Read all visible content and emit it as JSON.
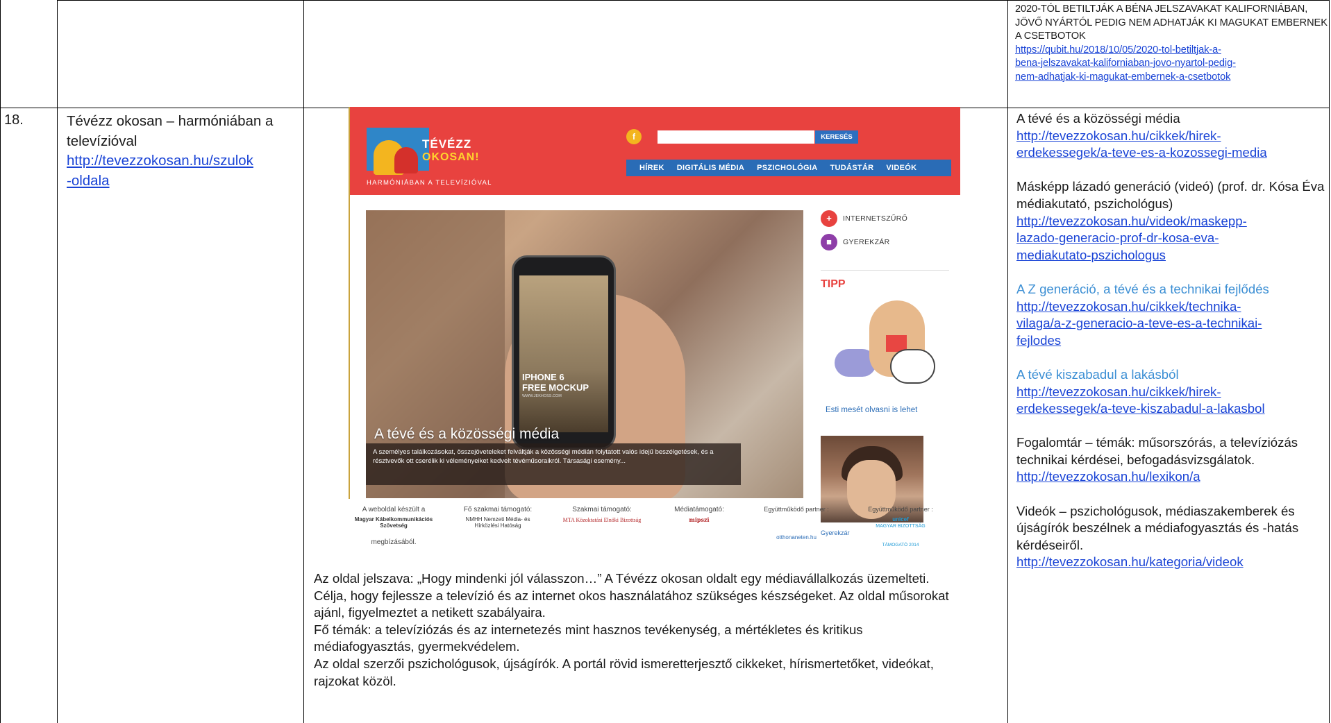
{
  "row17": {
    "headline": "2020-TÓL BETILTJÁK A BÉNA JELSZAVAKAT KALIFORNIÁBAN, JÖVŐ NYÁRTÓL PEDIG NEM ADHATJÁK KI MAGUKAT EMBERNEK A CSETBOTOK",
    "url_lines": [
      "https://qubit.hu/2018/10/05/2020-tol-betiltjak-a-",
      "bena-jelszavakat-kaliforniaban-jovo-nyartol-pedig-",
      "nem-adhatjak-ki-magukat-embernek-a-csetbotok"
    ]
  },
  "row18": {
    "number": "18.",
    "title": "Tévézz okosan – harmóniában a televízióval",
    "url_lines": [
      "http://tevezzokosan.hu/szulok",
      "-oldala"
    ],
    "description": [
      "Az oldal jelszava: „Hogy mindenki jól válasszon…” A Tévézz okosan oldalt egy médiavállalkozás üzemelteti.",
      "Célja, hogy fejlessze a televízió és az internet okos használatához szükséges készségeket. Az oldal műsorokat ajánl, figyelmeztet a netikett szabályaira.",
      "Fő témák: a televíziózás és az internetezés mint hasznos tevékenység, a mértékletes és kritikus médiafogyasztás, gyermekvédelem.",
      "Az oldal szerzői pszichológusok, újságírók. A portál rövid ismeretterjesztő cikkeket, hírismertetőket, videókat, rajzokat közöl."
    ],
    "refs": [
      {
        "title": "A tévé és a közösségi média",
        "url_lines": [
          "http://tevezzokosan.hu/cikkek/hirek-",
          "erdekessegek/a-teve-es-a-kozossegi-media"
        ],
        "accent": false
      },
      {
        "title": "Másképp lázadó generáció (videó) (prof. dr. Kósa Éva médiakutató, pszichológus)",
        "url_lines": [
          "http://tevezzokosan.hu/videok/maskepp-",
          "lazado-generacio-prof-dr-kosa-eva-",
          "mediakutato-pszichologus"
        ],
        "accent": false
      },
      {
        "title": "A Z generáció, a tévé és a technikai fejlődés",
        "url_lines": [
          "http://tevezzokosan.hu/cikkek/technika-",
          "vilaga/a-z-generacio-a-teve-es-a-technikai-",
          "fejlodes"
        ],
        "accent": true
      },
      {
        "title": "A tévé kiszabadul a lakásból",
        "url_lines": [
          "http://tevezzokosan.hu/cikkek/hirek-",
          "erdekessegek/a-teve-kiszabadul-a-lakasbol"
        ],
        "accent": true
      },
      {
        "title": "Fogalomtár – témák: műsorszórás, a televíziózás technikai kérdései, befogadásvizsgálatok.",
        "url_lines": [
          "http://tevezzokosan.hu/lexikon/a"
        ],
        "accent": false
      },
      {
        "title": "Videók – pszichológusok, médiaszakemberek és újságírók beszélnek a médiafogyasztás és -hatás kérdéseiről.",
        "url_lines": [
          "http://tevezzokosan.hu/kategoria/videok"
        ],
        "accent": false
      }
    ]
  },
  "site": {
    "logo_line1": "TÉVÉZZ",
    "logo_line2": "OKOSAN!",
    "logo_sub": "HARMÓNIÁBAN A TELEVÍZIÓVAL",
    "fb": "f",
    "search_button": "KERESÉS",
    "nav": [
      "HÍREK",
      "DIGITÁLIS MÉDIA",
      "PSZICHOLÓGIA",
      "TUDÁSTÁR",
      "VIDEÓK"
    ],
    "side_links": [
      "INTERNETSZŰRŐ",
      "GYEREKZÁR"
    ],
    "tipp": "TIPP",
    "tip_caption": "Esti mesét olvasni is lehet",
    "kid_caption": "Gyerekzár",
    "phone_line1": "IPHONE 6",
    "phone_line2": "FREE MOCKUP",
    "phone_line3": "WWW.JEKHOSS.COM",
    "hero_title": "A tévé és a közösségi média",
    "hero_caption": "A személyes találkozásokat, összejöveteleket felváltják a közösségi médián folytatott valós idejű beszélgetések, és a résztvevők ott cserélik ki véleményeiket kedvelt tévéműsoraikról. Társasági esemény...",
    "sponsors": [
      {
        "label": "A weboldal készült a",
        "logo": "Magyar Kábelkommunikációs Szövetség",
        "foot": "megbízásából."
      },
      {
        "label": "Fő szakmai támogató:",
        "logo": "NMHH Nemzeti Média- és Hírközlési Hatóság"
      },
      {
        "label": "Szakmai támogató:",
        "logo": "MTA Közoktatási Elnöki Bizottság"
      },
      {
        "label": "Médiatámogató:",
        "logo": "mipszi"
      },
      {
        "label": "Együttműködő partner :",
        "logo": "otthonaneten.hu"
      },
      {
        "label": "Együttműködő partner :",
        "logo": "unicef",
        "sub": "MAGYAR BIZOTTSÁG",
        "foot": "TÁMOGATÓ 2014"
      }
    ]
  }
}
